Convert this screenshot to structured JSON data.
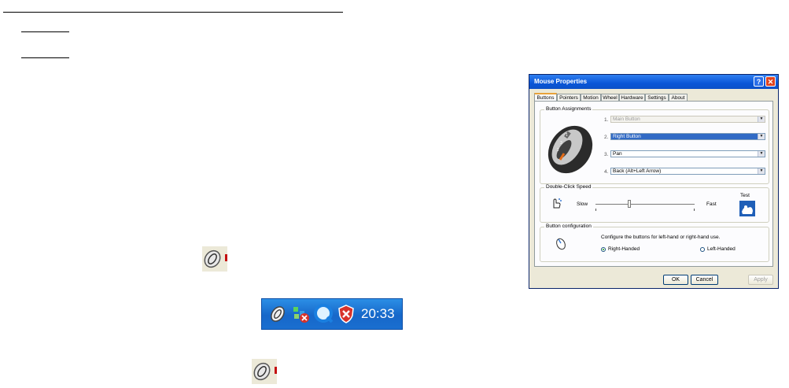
{
  "dialog": {
    "title": "Mouse Properties",
    "help_glyph": "?",
    "close_glyph": "✕",
    "tabs": [
      {
        "label": "Buttons",
        "active": true
      },
      {
        "label": "Pointers",
        "active": false
      },
      {
        "label": "Motion",
        "active": false
      },
      {
        "label": "Wheel",
        "active": false
      },
      {
        "label": "Hardware",
        "active": false
      },
      {
        "label": "Settings",
        "active": false
      },
      {
        "label": "About",
        "active": false
      }
    ],
    "button_assignments": {
      "group_label": "Button Assignments",
      "rows": [
        {
          "num": "1.",
          "value": "Main Button",
          "state": "disabled"
        },
        {
          "num": "2.",
          "value": "Right Button",
          "state": "selected"
        },
        {
          "num": "3.",
          "value": "Pan",
          "state": "normal"
        },
        {
          "num": "4.",
          "value": "Back (Alt+Left Arrow)",
          "state": "normal"
        }
      ]
    },
    "double_click": {
      "group_label": "Double-Click Speed",
      "slow_label": "Slow",
      "fast_label": "Fast",
      "test_label": "Test",
      "speed_fraction": 0.34
    },
    "button_config": {
      "group_label": "Button configuration",
      "description": "Configure the buttons for left-hand or right-hand use.",
      "right_label": "Right-Handed",
      "left_label": "Left-Handed",
      "selected": "right"
    },
    "footer": {
      "ok": "OK",
      "cancel": "Cancel",
      "apply": "Apply"
    }
  },
  "tray": {
    "clock": "20:33",
    "icons": [
      "mouse-keyboard-icon",
      "network-disconnected-icon",
      "quicktime-icon",
      "security-shield-icon"
    ]
  },
  "colors": {
    "titlebar": "#0a56d8",
    "taskbar": "#1767c9",
    "selection": "#316ac5",
    "accent_red": "#c41010"
  }
}
